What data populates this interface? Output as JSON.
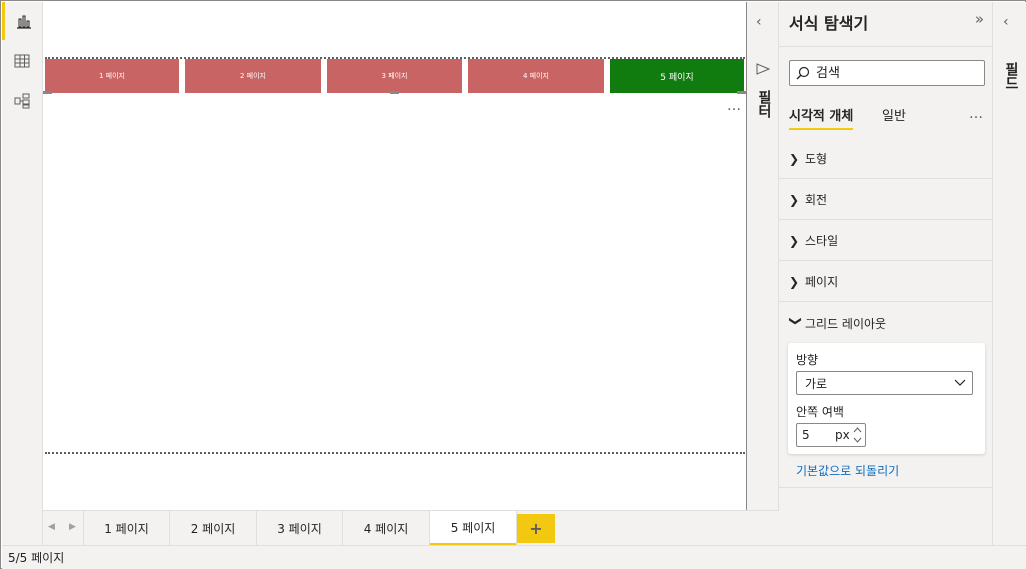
{
  "canvas": {
    "nav_buttons": [
      {
        "label": "1 페이지",
        "active": false
      },
      {
        "label": "2 페이지",
        "active": false
      },
      {
        "label": "3 페이지",
        "active": false
      },
      {
        "label": "4 페이지",
        "active": false
      },
      {
        "label": "5 페이지",
        "active": true
      }
    ],
    "more_options": "…",
    "colors": {
      "inactive_button": "#c86464",
      "active_button": "#107c10"
    }
  },
  "left_rail": {
    "items": [
      {
        "icon": "report-view-icon",
        "active": true
      },
      {
        "icon": "table-view-icon",
        "active": false
      },
      {
        "icon": "model-view-icon",
        "active": false
      }
    ]
  },
  "filters_strip": {
    "label": "필터",
    "icon": "filter-icon"
  },
  "format_pane": {
    "title": "서식 탐색기",
    "search_placeholder": "검색",
    "tabs": [
      {
        "label": "시각적 개체",
        "active": true
      },
      {
        "label": "일반",
        "active": false
      }
    ],
    "more_options": "…",
    "sections": [
      {
        "label": "도형",
        "expanded": false
      },
      {
        "label": "회전",
        "expanded": false
      },
      {
        "label": "스타일",
        "expanded": false
      },
      {
        "label": "페이지",
        "expanded": false
      },
      {
        "label": "그리드 레이아웃",
        "expanded": true
      }
    ],
    "grid_layout": {
      "orientation_label": "방향",
      "orientation_value": "가로",
      "padding_label": "안쪽 여백",
      "padding_value": "5",
      "padding_unit": "px"
    },
    "reset_link": "기본값으로 되돌리기"
  },
  "fields_strip": {
    "label": "필드"
  },
  "page_tabs": {
    "tabs": [
      {
        "label": "1 페이지",
        "active": false
      },
      {
        "label": "2 페이지",
        "active": false
      },
      {
        "label": "3 페이지",
        "active": false
      },
      {
        "label": "4 페이지",
        "active": false
      },
      {
        "label": "5 페이지",
        "active": true
      }
    ],
    "add_label": "+"
  },
  "status_bar": {
    "page_indicator": "5/5 페이지"
  },
  "accent_color": "#f2c811"
}
